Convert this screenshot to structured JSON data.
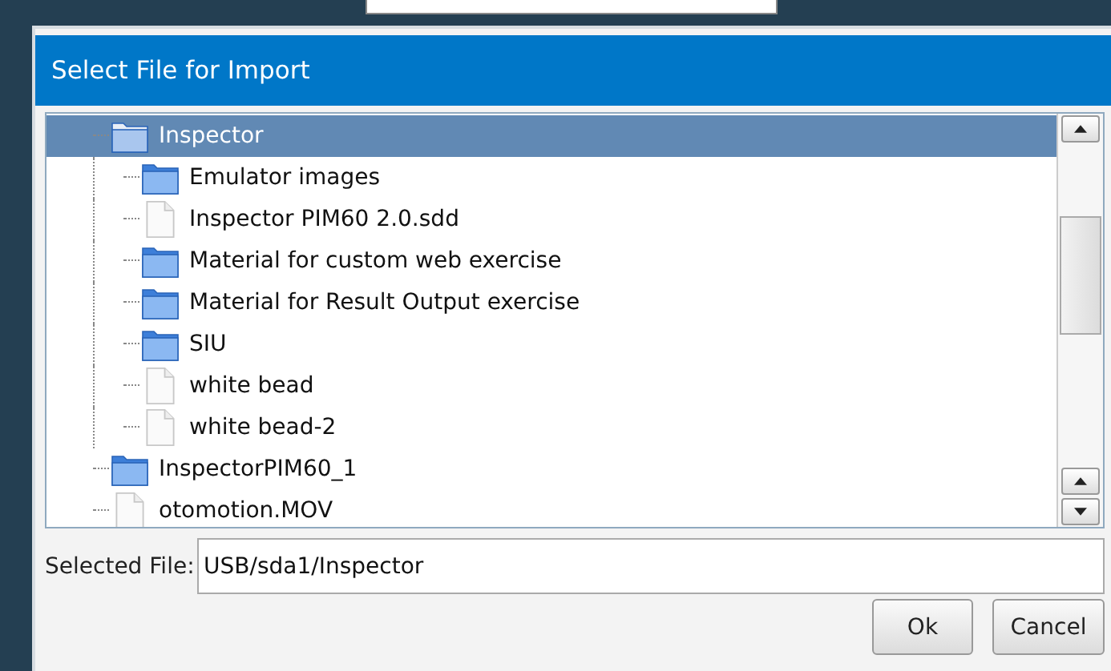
{
  "dialog": {
    "title": "Select File for Import"
  },
  "tree": [
    {
      "name": "Inspector",
      "kind": "folder",
      "selected": true,
      "children": [
        {
          "name": "Emulator images",
          "kind": "folder",
          "selected": false
        },
        {
          "name": "Inspector PIM60 2.0.sdd",
          "kind": "file",
          "selected": false
        },
        {
          "name": "Material for custom web exercise",
          "kind": "folder",
          "selected": false
        },
        {
          "name": "Material for Result Output exercise",
          "kind": "folder",
          "selected": false
        },
        {
          "name": "SIU",
          "kind": "folder",
          "selected": false
        },
        {
          "name": "white bead",
          "kind": "file",
          "selected": false
        },
        {
          "name": "white bead-2",
          "kind": "file",
          "selected": false
        }
      ]
    },
    {
      "name": "InspectorPIM60_1",
      "kind": "folder",
      "selected": false
    },
    {
      "name": "otomotion.MOV",
      "kind": "file",
      "selected": false
    }
  ],
  "selected_file": {
    "label": "Selected File:",
    "value": "USB/sda1/Inspector"
  },
  "buttons": [
    "Ok",
    "Cancel"
  ]
}
